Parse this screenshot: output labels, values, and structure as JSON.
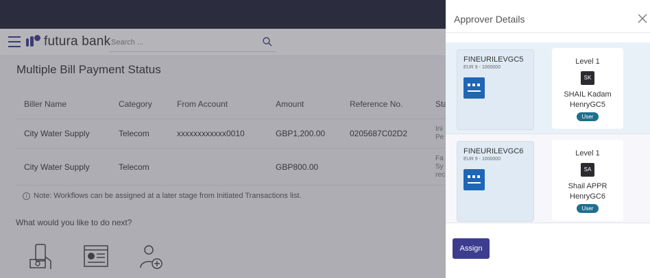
{
  "header": {
    "brand": "futura bank",
    "search_placeholder": "Search ..."
  },
  "page": {
    "title": "Multiple Bill Payment Status"
  },
  "table": {
    "columns": [
      "Biller Name",
      "Category",
      "From Account",
      "Amount",
      "Reference No.",
      "Sta"
    ],
    "rows": [
      {
        "biller": "City Water Supply",
        "category": "Telecom",
        "account": "xxxxxxxxxxxx0010",
        "amount": "GBP1,200.00",
        "reference": "0205687C02D2",
        "status": "Ini",
        "status2": "Pe"
      },
      {
        "biller": "City Water Supply",
        "category": "Telecom",
        "account": "",
        "amount": "GBP800.00",
        "reference": "",
        "status": "Fa",
        "status2": "Sy",
        "status3": "rec"
      }
    ]
  },
  "note": "Note: Workflows can be assigned at a later stage from Initiated Transactions list.",
  "next": "What would you like to do next?",
  "panel": {
    "title": "Approver Details",
    "approvers": [
      {
        "account": "FINEURILEVGC5",
        "account_sub": "EUR 9 - 1000000",
        "level": "Level 1",
        "initials": "SK",
        "name": "SHAIL Kadam",
        "user_id": "HenryGC5",
        "role": "User"
      },
      {
        "account": "FINEURILEVGC6",
        "account_sub": "EUR 9 - 1000000",
        "level": "Level 1",
        "initials": "SA",
        "name": "Shail APPR",
        "user_id": "HenryGC6",
        "role": "User"
      }
    ],
    "assign_label": "Assign"
  }
}
